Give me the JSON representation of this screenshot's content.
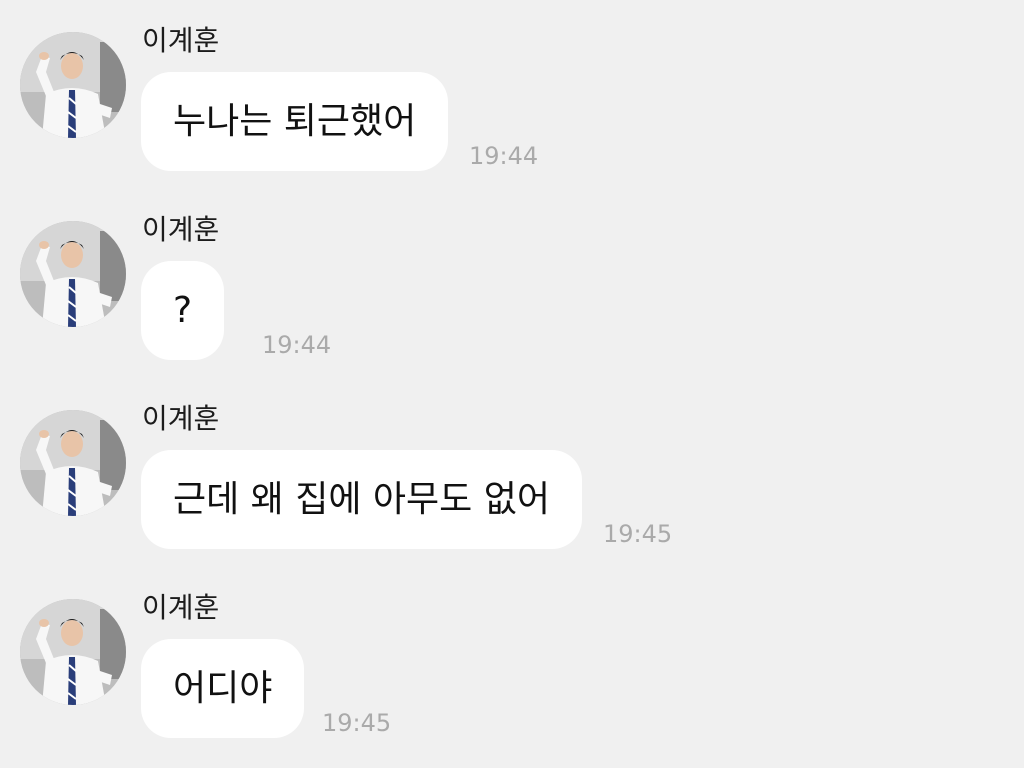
{
  "messages": [
    {
      "sender": "이계훈",
      "text": "누나는 퇴근했어",
      "time": "19:44"
    },
    {
      "sender": "이계훈",
      "text": "?",
      "time": "19:44"
    },
    {
      "sender": "이계훈",
      "text": "근데 왜 집에 아무도 없어",
      "time": "19:45"
    },
    {
      "sender": "이계훈",
      "text": "어디야",
      "time": "19:45"
    }
  ],
  "colors": {
    "background": "#f0f0f0",
    "bubble": "#ffffff",
    "timestamp": "#aaaaaa"
  },
  "icons": {
    "avatar": "profile-photo"
  }
}
